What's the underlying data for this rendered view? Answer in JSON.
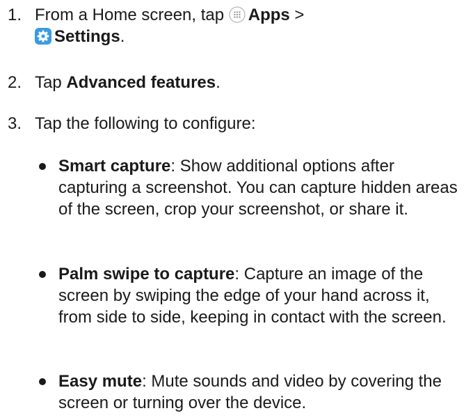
{
  "steps": [
    {
      "number": "1.",
      "text_before": "From a Home screen, tap ",
      "apps_label": "Apps",
      "separator": " >",
      "settings_label": "Settings",
      "text_after": "."
    },
    {
      "number": "2.",
      "text_before": "Tap ",
      "bold": "Advanced features",
      "text_after": "."
    },
    {
      "number": "3.",
      "text": "Tap the following to configure:"
    }
  ],
  "bullets": [
    {
      "term": "Smart capture",
      "description": ": Show additional options after capturing a screenshot. You can capture hidden areas of the screen, crop your screenshot, or share it."
    },
    {
      "term": "Palm swipe to capture",
      "description": ": Capture an image of the screen by swiping the edge of your hand across it, from side to side, keeping in contact with the screen."
    },
    {
      "term": "Easy mute",
      "description": ": Mute sounds and video by covering the screen or turning over the device."
    }
  ],
  "icons": {
    "apps": "apps-grid-icon",
    "settings": "settings-gear-icon",
    "settings_color": "#3a9be0"
  }
}
